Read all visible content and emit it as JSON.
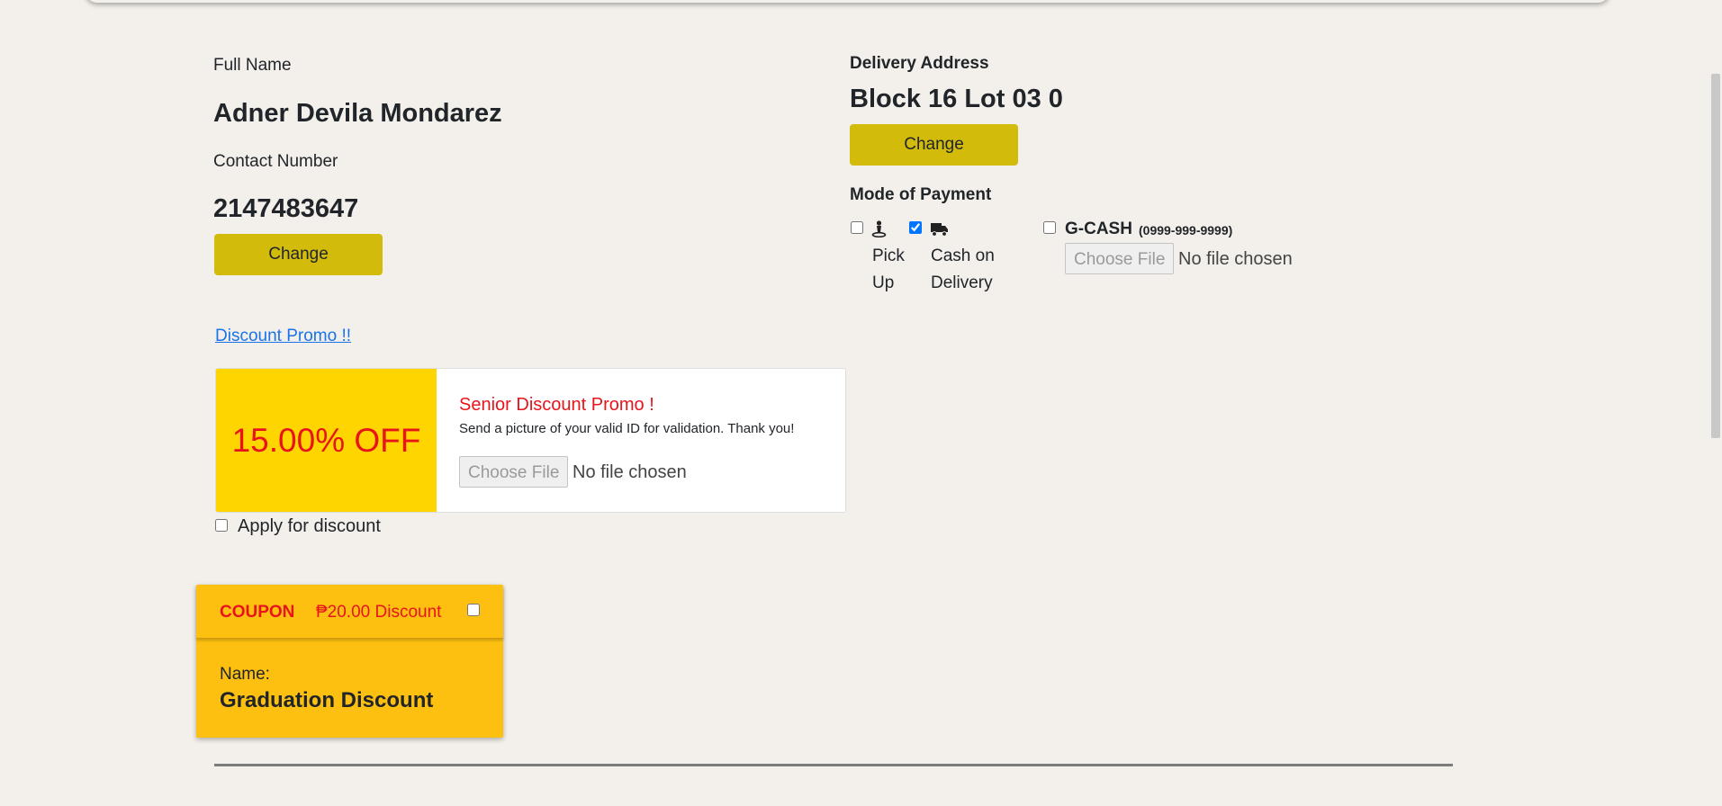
{
  "customer": {
    "full_name_label": "Full Name",
    "full_name": "Adner Devila Mondarez",
    "contact_label": "Contact Number",
    "contact": "2147483647",
    "change_label": "Change"
  },
  "delivery": {
    "address_label": "Delivery Address",
    "address": "Block 16 Lot 03 0",
    "change_label": "Change"
  },
  "payment": {
    "label": "Mode of Payment",
    "options": [
      {
        "icon": "person-pickup-icon",
        "label_line1": "Pick",
        "label_line2": "Up",
        "checked": false
      },
      {
        "icon": "truck-icon",
        "label_line1": "Cash on",
        "label_line2": "Delivery",
        "checked": true
      },
      {
        "label": "G-CASH",
        "number": "(0999-999-9999)",
        "checked": false
      }
    ],
    "file_button": "Choose File",
    "file_status": "No file chosen"
  },
  "discount": {
    "link_text": "Discount Promo !!",
    "percent": "15.00% OFF",
    "title": "Senior Discount Promo !",
    "description": "Send a picture of your valid ID for validation. Thank you!",
    "file_button": "Choose File",
    "file_status": "No file chosen",
    "apply_label": "Apply for discount",
    "apply_checked": false
  },
  "coupon": {
    "tag": "COUPON",
    "amount": "₱20.00 Discount",
    "name_label": "Name:",
    "name": "Graduation Discount",
    "checked": false
  },
  "colors": {
    "background": "#f3f0eb",
    "change_button": "#d2bb0a",
    "promo_yellow": "#ffd500",
    "promo_red": "#e8141c",
    "coupon_bg": "#fdc010",
    "link_blue": "#1a73e8"
  }
}
